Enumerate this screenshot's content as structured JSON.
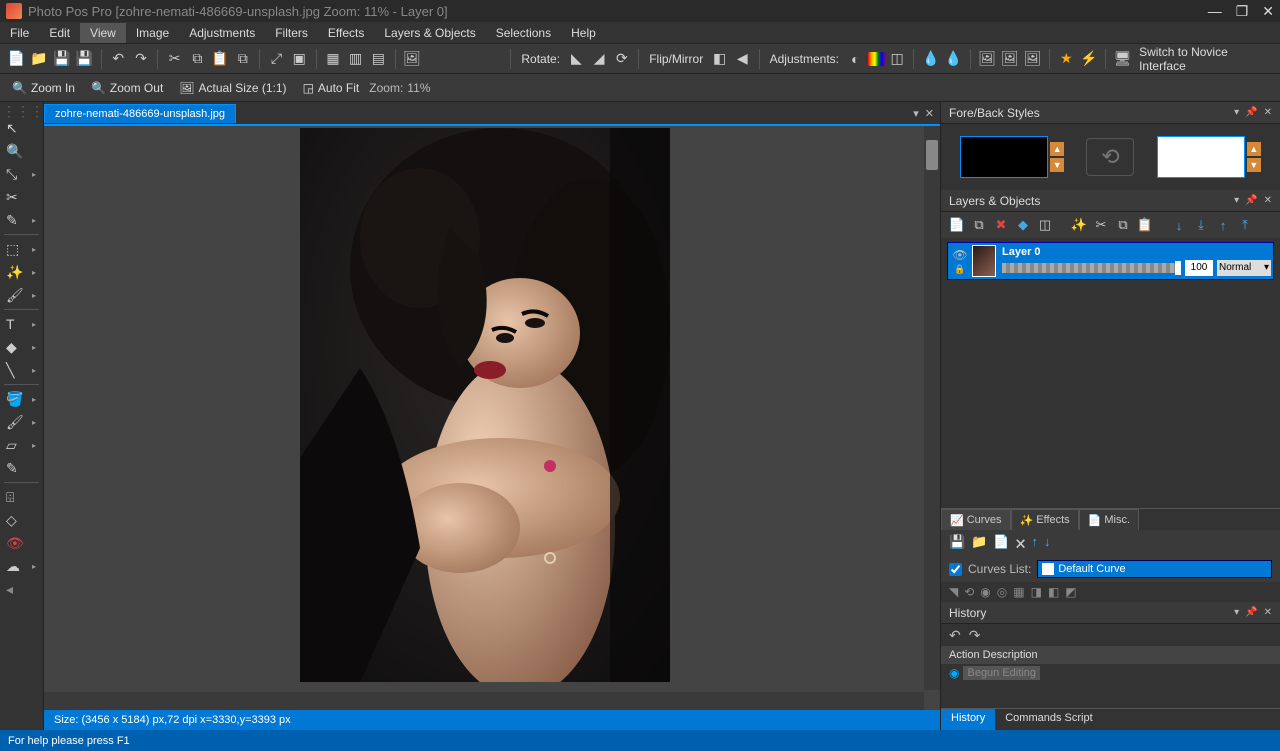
{
  "title": "Photo Pos Pro [zohre-nemati-486669-unsplash.jpg Zoom: 11% - Layer 0]",
  "menu": [
    "File",
    "Edit",
    "View",
    "Image",
    "Adjustments",
    "Filters",
    "Effects",
    "Layers & Objects",
    "Selections",
    "Help"
  ],
  "menu_active_index": 2,
  "toolbar": {
    "rotate_label": "Rotate:",
    "flip_label": "Flip/Mirror",
    "adjust_label": "Adjustments:",
    "switch_label": "Switch to Novice Interface"
  },
  "zoombar": {
    "zoomin": "Zoom In",
    "zoomout": "Zoom Out",
    "actual": "Actual Size (1:1)",
    "autofit": "Auto Fit",
    "zoom_label": "Zoom:",
    "zoom_value": "11%"
  },
  "doctab": "zohre-nemati-486669-unsplash.jpg",
  "status": "Size: (3456 x 5184) px,72 dpi   x=3330,y=3393 px",
  "panels": {
    "foreback": "Fore/Back Styles",
    "layers": "Layers & Objects",
    "history": "History"
  },
  "layer": {
    "name": "Layer 0",
    "opacity": "100",
    "blend": "Normal"
  },
  "curves": {
    "tabs": [
      "Curves",
      "Effects",
      "Misc."
    ],
    "list_label": "Curves List:",
    "default": "Default Curve"
  },
  "history": {
    "header": "Action Description",
    "item": "Begun Editing",
    "tabs": [
      "History",
      "Commands Script"
    ]
  },
  "helpbar": "For help please press F1"
}
